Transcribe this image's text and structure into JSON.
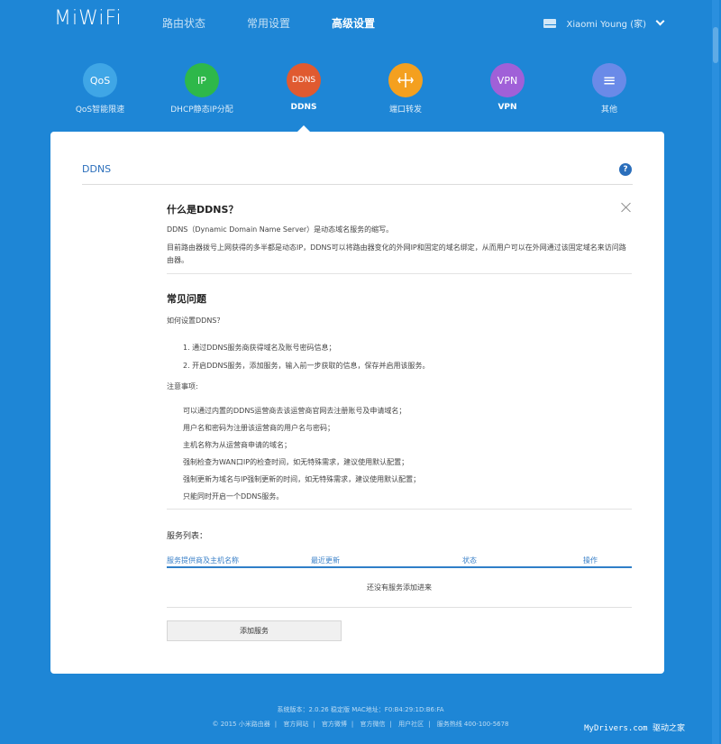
{
  "app": {
    "logo": "MiWiFi"
  },
  "topnav": [
    {
      "label": "路由状态"
    },
    {
      "label": "常用设置"
    },
    {
      "label": "高级设置"
    }
  ],
  "user": {
    "name": "Xiaomi Young (家)"
  },
  "features": [
    {
      "icon_text": "QoS",
      "label": "QoS智能限速",
      "color": "#3fa6e6"
    },
    {
      "icon_text": "IP",
      "label": "DHCP静态IP分配",
      "color": "#2eb84a"
    },
    {
      "icon_text": "DDNS",
      "label": "DDNS",
      "color": "#e05a30"
    },
    {
      "icon_text": "",
      "label": "端口转发",
      "color": "#f4a01f"
    },
    {
      "icon_text": "VPN",
      "label": "VPN",
      "color": "#a060d8"
    },
    {
      "icon_text": "≡",
      "label": "其他",
      "color": "#6a8ae8"
    }
  ],
  "panel": {
    "title": "DDNS",
    "help": "?",
    "what_title": "什么是DDNS？",
    "what_p1": "DDNS（Dynamic Domain Name Server）是动态域名服务的缩写。",
    "what_p2": "目前路由器拨号上网获得的多半都是动态IP，DDNS可以将路由器变化的外网IP和固定的域名绑定，从而用户可以在外网通过该固定域名来访问路由器。",
    "faq_title": "常见问题",
    "faq_q": "如何设置DDNS？",
    "steps": [
      "1. 通过DDNS服务商获得域名及账号密码信息；",
      "2. 开启DDNS服务，添加服务，输入前一步获取的信息，保存并启用该服务。"
    ],
    "notes_title": "注意事项:",
    "notes": [
      "可以通过内置的DDNS运营商去该运营商官网去注册账号及申请域名；",
      "用户名和密码为注册该运营商的用户名与密码；",
      "主机名称为从运营商申请的域名；",
      "强制检查为WAN口IP的检查时间，如无特殊需求，建议使用默认配置；",
      "强制更新为域名与IP强制更新的时间，如无特殊需求，建议使用默认配置；",
      "只能同时开启一个DDNS服务。"
    ],
    "service_list_title": "服务列表：",
    "table_headers": [
      "服务提供商及主机名称",
      "最近更新",
      "状态",
      "操作"
    ],
    "empty_text": "还没有服务添加进来",
    "add_button": "添加服务"
  },
  "footer": {
    "line1": "系统版本：2.0.26 稳定版   MAC地址：F0:B4:29:1D:B6:FA",
    "links": [
      "© 2015 小米路由器",
      "官方网站",
      "官方微博",
      "官方微信",
      "用户社区",
      "服务热线 400-100-5678"
    ]
  },
  "watermark": "MyDrivers.com 驱动之家"
}
